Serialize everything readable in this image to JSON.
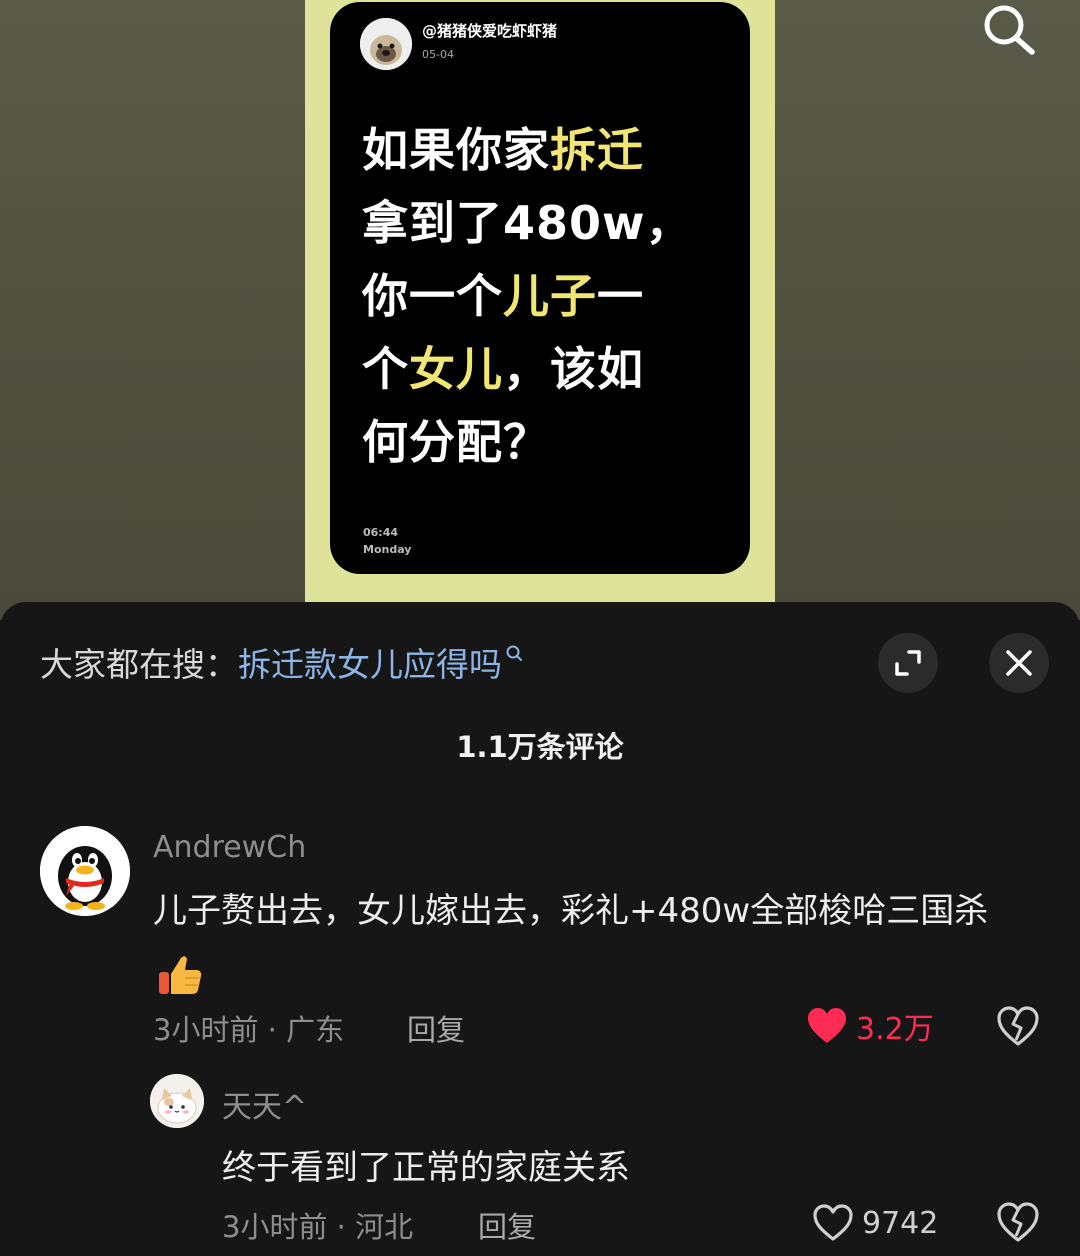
{
  "poster": {
    "username": "@猪猪侠爱吃虾虾猪",
    "date": "05-04",
    "lines": [
      [
        {
          "t": "如果你家",
          "hl": false
        },
        {
          "t": "拆迁",
          "hl": true
        }
      ],
      [
        {
          "t": "拿到了480w，",
          "hl": false
        }
      ],
      [
        {
          "t": "你一个",
          "hl": false
        },
        {
          "t": "儿子",
          "hl": true
        },
        {
          "t": "一",
          "hl": false
        }
      ],
      [
        {
          "t": "个",
          "hl": false
        },
        {
          "t": "女儿",
          "hl": true
        },
        {
          "t": "，该如",
          "hl": false
        }
      ],
      [
        {
          "t": "何分配？",
          "hl": false
        }
      ]
    ],
    "time": "06:44",
    "weekday": "Monday"
  },
  "header": {
    "search_icon": "search-icon"
  },
  "panel": {
    "hot_search_prefix": "大家都在搜：",
    "hot_search_keyword": "拆迁款女儿应得吗",
    "expand_icon": "expand-icon",
    "close_icon": "close-icon",
    "comment_count": "1.1万条评论"
  },
  "comments": {
    "main": {
      "username": "AndrewCh",
      "text": "儿子赘出去，女儿嫁出去，彩礼+480w全部梭哈三国杀",
      "emoji": "thumbs-up-icon",
      "meta": "3小时前 · 广东",
      "reply_label": "回复",
      "likes": "3.2万",
      "liked": true
    },
    "reply": {
      "username": "天天^",
      "text": "终于看到了正常的家庭关系",
      "meta": "3小时前 · 河北",
      "reply_label": "回复",
      "likes": "9742",
      "liked": false
    }
  },
  "colors": {
    "accent_like": "#fe2c55",
    "highlight": "#f2e673",
    "keyword": "#8cb4e6"
  }
}
